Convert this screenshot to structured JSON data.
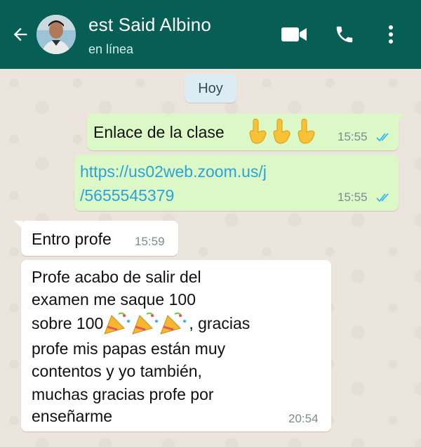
{
  "header": {
    "contact_name": "est Said Albino",
    "status": "en línea",
    "icons": [
      "back-arrow-icon",
      "video-call-icon",
      "phone-icon",
      "more-options-icon"
    ]
  },
  "chat": {
    "date_chip": "Hoy",
    "messages": [
      {
        "direction": "out",
        "text": "Enlace de la clase",
        "emoji": "backhand-index-pointing-down x3",
        "time": "15:55",
        "status": "read"
      },
      {
        "direction": "out",
        "link_line1": "https://us02web.zoom.us/j",
        "link_line2": "/5655545379",
        "time": "15:55",
        "status": "read"
      },
      {
        "direction": "in",
        "text": "Entro profe",
        "time": "15:59"
      },
      {
        "direction": "in",
        "line1": "Profe acabo de salir del",
        "line2": "examen me saque 100",
        "line3a": "sobre 100",
        "line3b": ", gracias",
        "line4": "profe mis papas están muy",
        "line5": "contentos y yo también,",
        "line6": "muchas gracias profe por",
        "line7": "enseñarme",
        "emoji": "party-popper x3",
        "time": "20:54"
      }
    ]
  },
  "colors": {
    "header_bg": "#075e54",
    "outgoing_bubble": "#dcf8c6",
    "incoming_bubble": "#ffffff",
    "chat_bg": "#ece5dd",
    "read_ticks": "#34b7f1",
    "link": "#2aa4d8"
  }
}
